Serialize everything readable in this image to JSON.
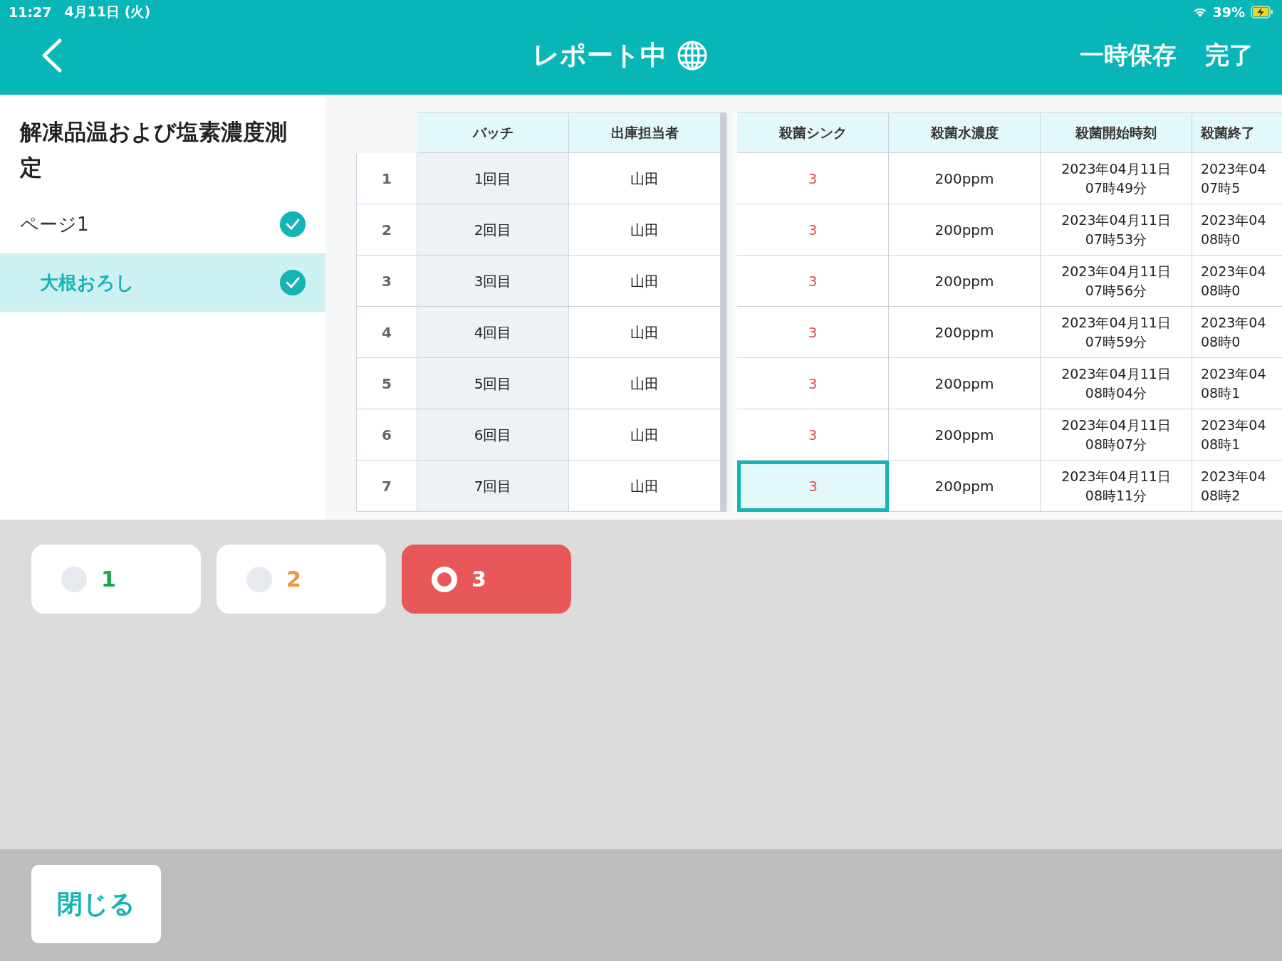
{
  "status_bar": {
    "time": "11:27",
    "date": "4月11日 (火)",
    "battery": "39%"
  },
  "header": {
    "title": "レポート中",
    "actions": [
      "一時保存",
      "完了"
    ]
  },
  "sidebar": {
    "title": "解凍品温および塩素濃度測定",
    "items": [
      {
        "label": "ページ1",
        "checked": true,
        "selected": false,
        "children": [
          {
            "label": "大根おろし",
            "checked": true,
            "selected": true
          }
        ]
      }
    ]
  },
  "table": {
    "columns": [
      "バッチ",
      "出庫担当者",
      "殺菌シンク",
      "殺菌水濃度",
      "殺菌開始時刻",
      "殺菌終了"
    ],
    "rows": [
      {
        "number": "1",
        "batch": "1回目",
        "person": "山田",
        "sink": "3",
        "concentration": "200ppm",
        "start": [
          "2023年04月11日",
          "07時49分"
        ],
        "end": [
          "2023年04",
          "07時5"
        ],
        "selected": false
      },
      {
        "number": "2",
        "batch": "2回目",
        "person": "山田",
        "sink": "3",
        "concentration": "200ppm",
        "start": [
          "2023年04月11日",
          "07時53分"
        ],
        "end": [
          "2023年04",
          "08時0"
        ],
        "selected": false
      },
      {
        "number": "3",
        "batch": "3回目",
        "person": "山田",
        "sink": "3",
        "concentration": "200ppm",
        "start": [
          "2023年04月11日",
          "07時56分"
        ],
        "end": [
          "2023年04",
          "08時0"
        ],
        "selected": false
      },
      {
        "number": "4",
        "batch": "4回目",
        "person": "山田",
        "sink": "3",
        "concentration": "200ppm",
        "start": [
          "2023年04月11日",
          "07時59分"
        ],
        "end": [
          "2023年04",
          "08時0"
        ],
        "selected": false
      },
      {
        "number": "5",
        "batch": "5回目",
        "person": "山田",
        "sink": "3",
        "concentration": "200ppm",
        "start": [
          "2023年04月11日",
          "08時04分"
        ],
        "end": [
          "2023年04",
          "08時1"
        ],
        "selected": false
      },
      {
        "number": "6",
        "batch": "6回目",
        "person": "山田",
        "sink": "3",
        "concentration": "200ppm",
        "start": [
          "2023年04月11日",
          "08時07分"
        ],
        "end": [
          "2023年04",
          "08時1"
        ],
        "selected": false
      },
      {
        "number": "7",
        "batch": "7回目",
        "person": "山田",
        "sink": "3",
        "concentration": "200ppm",
        "start": [
          "2023年04月11日",
          "08時11分"
        ],
        "end": [
          "2023年04",
          "08時2"
        ],
        "selected": true
      }
    ]
  },
  "options": [
    {
      "label": "1",
      "color": "#1aa352",
      "selected": false
    },
    {
      "label": "2",
      "color": "#f0963c",
      "selected": false
    },
    {
      "label": "3",
      "color": "#e95858",
      "selected": true
    }
  ],
  "footer": {
    "close": "閉じる"
  }
}
